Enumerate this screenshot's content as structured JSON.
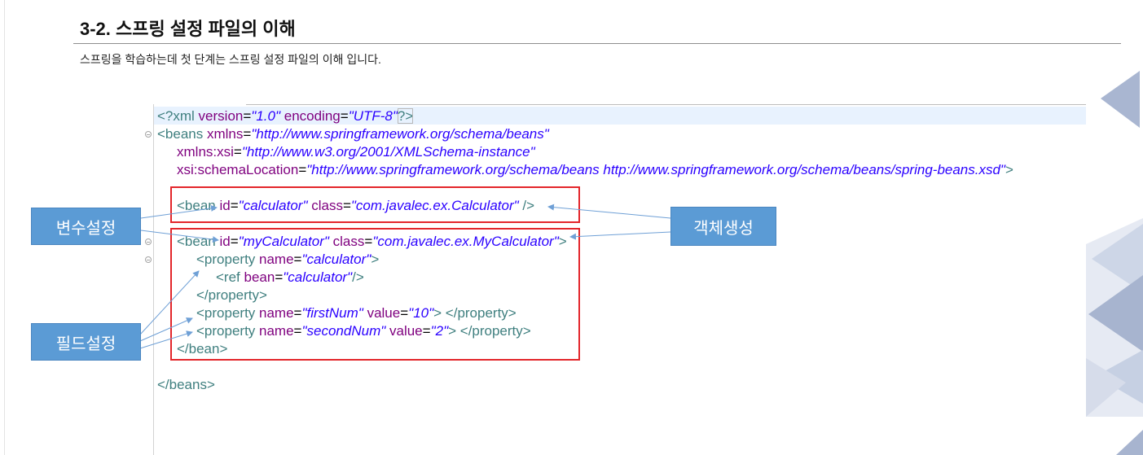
{
  "page": {
    "title": "3-2. 스프링 설정 파일의 이해",
    "subtitle": "스프링을 학습하는데 첫 단계는 스프링 설정 파일의 이해 입니다."
  },
  "callouts": {
    "variable_setting": "변수설정",
    "object_creation": "객체생성",
    "field_setting": "필드설정"
  },
  "colors": {
    "callout_fill": "#5b9bd5",
    "callout_text": "#ffffff",
    "box_border": "#e3262b",
    "arrow": "#6fa0d6",
    "tag": "#3f7f7f",
    "attr": "#7f007f",
    "value": "#2a00ff",
    "plain": "#000000",
    "line_highlight": "#e8f2fe"
  },
  "code": {
    "lines": [
      {
        "tokens": [
          {
            "tag": "<?xml "
          },
          {
            "attr": "version"
          },
          {
            "plain": "="
          },
          {
            "val": "\"1.0\""
          },
          {
            "plain": " "
          },
          {
            "attr": "encoding"
          },
          {
            "plain": "="
          },
          {
            "val": "\"UTF-8\""
          },
          {
            "match": "?>"
          }
        ]
      },
      {
        "fold": true,
        "tokens": [
          {
            "tag": "<beans "
          },
          {
            "attr": "xmlns"
          },
          {
            "plain": "="
          },
          {
            "val": "\"http://www.springframework.org/schema/beans\""
          }
        ]
      },
      {
        "tokens": [
          {
            "plain": "\t"
          },
          {
            "attr": "xmlns:xsi"
          },
          {
            "plain": "="
          },
          {
            "val": "\"http://www.w3.org/2001/XMLSchema-instance\""
          }
        ]
      },
      {
        "tokens": [
          {
            "plain": "\t"
          },
          {
            "attr": "xsi:schemaLocation"
          },
          {
            "plain": "="
          },
          {
            "val": "\"http://www.springframework.org/schema/beans http://www.springframework.org/schema/beans/spring-beans.xsd\""
          },
          {
            "tag": ">"
          }
        ]
      },
      {
        "tokens": []
      },
      {
        "tokens": [
          {
            "plain": "\t"
          },
          {
            "tag": "<bean "
          },
          {
            "attr": "id"
          },
          {
            "plain": "="
          },
          {
            "val": "\"calculator\""
          },
          {
            "plain": " "
          },
          {
            "attr": "class"
          },
          {
            "plain": "="
          },
          {
            "val": "\"com.javalec.ex.Calculator\""
          },
          {
            "plain": " "
          },
          {
            "tag": "/>"
          }
        ]
      },
      {
        "tokens": []
      },
      {
        "fold": true,
        "tokens": [
          {
            "plain": "\t"
          },
          {
            "tag": "<bean "
          },
          {
            "attr": "id"
          },
          {
            "plain": "="
          },
          {
            "val": "\"myCalculator\""
          },
          {
            "plain": " "
          },
          {
            "attr": "class"
          },
          {
            "plain": "="
          },
          {
            "val": "\"com.javalec.ex.MyCalculator\""
          },
          {
            "tag": ">"
          }
        ]
      },
      {
        "fold": true,
        "tokens": [
          {
            "plain": "\t\t"
          },
          {
            "tag": "<property "
          },
          {
            "attr": "name"
          },
          {
            "plain": "="
          },
          {
            "val": "\"calculator\""
          },
          {
            "tag": ">"
          }
        ]
      },
      {
        "tokens": [
          {
            "plain": "\t\t\t"
          },
          {
            "tag": "<ref "
          },
          {
            "attr": "bean"
          },
          {
            "plain": "="
          },
          {
            "val": "\"calculator\""
          },
          {
            "tag": "/>"
          }
        ]
      },
      {
        "tokens": [
          {
            "plain": "\t\t"
          },
          {
            "tag": "</property>"
          }
        ]
      },
      {
        "tokens": [
          {
            "plain": "\t\t"
          },
          {
            "tag": "<property "
          },
          {
            "attr": "name"
          },
          {
            "plain": "="
          },
          {
            "val": "\"firstNum\""
          },
          {
            "plain": " "
          },
          {
            "attr": "value"
          },
          {
            "plain": "="
          },
          {
            "val": "\"10\""
          },
          {
            "tag": "> </property>"
          }
        ]
      },
      {
        "tokens": [
          {
            "plain": "\t\t"
          },
          {
            "tag": "<property "
          },
          {
            "attr": "name"
          },
          {
            "plain": "="
          },
          {
            "val": "\"secondNum\""
          },
          {
            "plain": " "
          },
          {
            "attr": "value"
          },
          {
            "plain": "="
          },
          {
            "val": "\"2\""
          },
          {
            "tag": "> </property>"
          }
        ]
      },
      {
        "tokens": [
          {
            "plain": "\t"
          },
          {
            "tag": "</bean>"
          }
        ]
      },
      {
        "tokens": []
      },
      {
        "tokens": [
          {
            "tag": "</beans>"
          }
        ]
      }
    ]
  }
}
